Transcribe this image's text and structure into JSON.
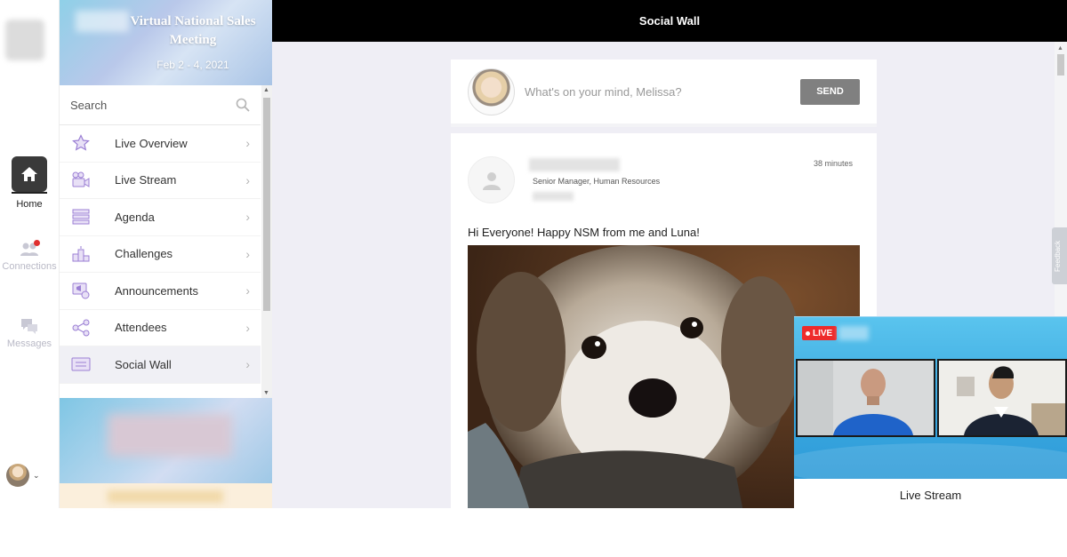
{
  "rail": {
    "items": [
      {
        "label": "Home",
        "icon": "home-icon"
      },
      {
        "label": "Connections",
        "icon": "people-icon"
      },
      {
        "label": "Messages",
        "icon": "chat-icon"
      }
    ],
    "profile_chevron": "⌄"
  },
  "event": {
    "title": "Virtual National Sales Meeting",
    "dates": "Feb 2 - 4, 2021",
    "search_placeholder": "Search",
    "menu": [
      {
        "label": "Live Overview",
        "icon": "star-icon"
      },
      {
        "label": "Live Stream",
        "icon": "video-camera-icon"
      },
      {
        "label": "Agenda",
        "icon": "list-icon"
      },
      {
        "label": "Challenges",
        "icon": "podium-icon"
      },
      {
        "label": "Announcements",
        "icon": "megaphone-icon"
      },
      {
        "label": "Attendees",
        "icon": "network-icon"
      },
      {
        "label": "Social Wall",
        "icon": "message-board-icon"
      }
    ],
    "active_menu": "Social Wall"
  },
  "header": {
    "title": "Social Wall"
  },
  "composer": {
    "placeholder": "What's on your mind, Melissa?",
    "send_label": "SEND"
  },
  "post": {
    "role": "Senior Manager, Human Resources",
    "time": "38 minutes",
    "text": "Hi Everyone! Happy NSM from me and Luna!"
  },
  "live": {
    "badge": "LIVE",
    "caption": "Live Stream"
  },
  "feedback_tab": "Feedback",
  "colors": {
    "accent_purple": "#9b7fd4",
    "live_red": "#ee2b2b",
    "header_black": "#000000",
    "send_gray": "#808080"
  }
}
